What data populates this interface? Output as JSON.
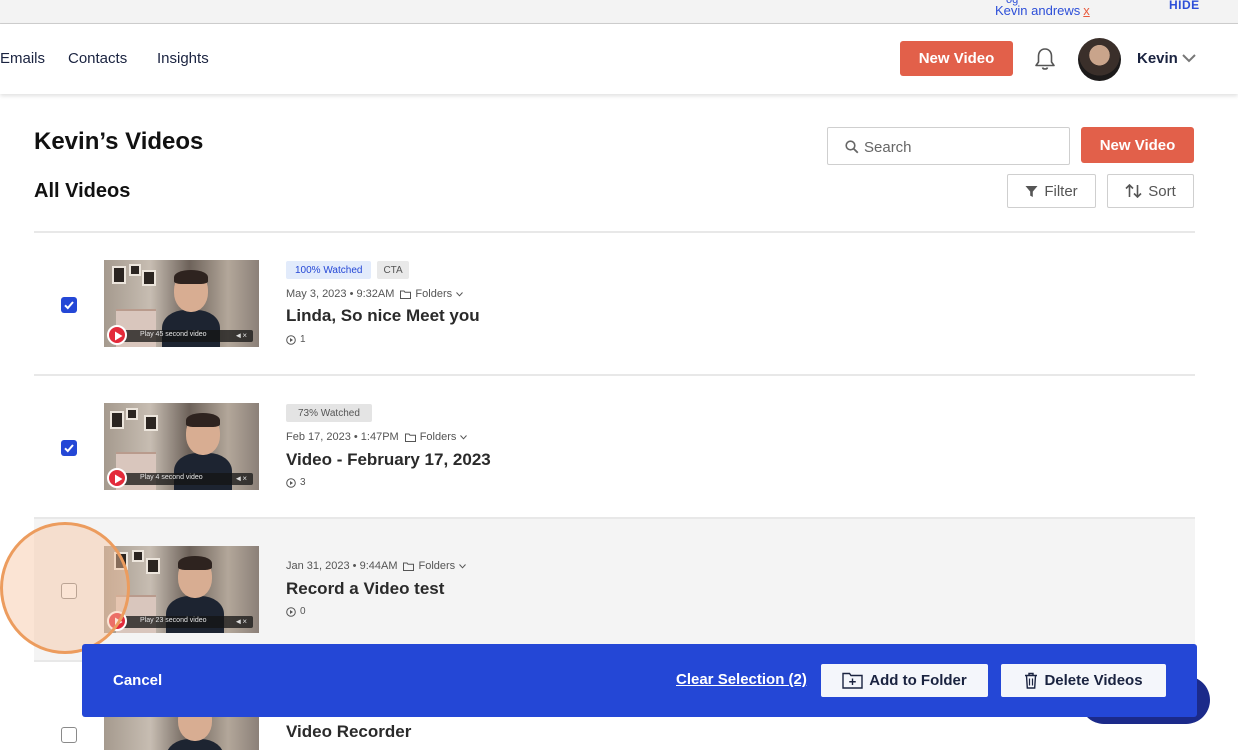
{
  "topbar": {
    "user": "Kevin andrews",
    "close": "x",
    "hide": "HIDE",
    "partial": "og"
  },
  "nav": {
    "links": [
      "Emails",
      "Contacts",
      "Insights"
    ],
    "new_video": "New Video",
    "user_name": "Kevin"
  },
  "header": {
    "title": "Kevin’s Videos",
    "section": "All Videos",
    "search_placeholder": "Search",
    "new_video": "New Video",
    "filter": "Filter",
    "sort": "Sort"
  },
  "videos": [
    {
      "badges": [
        "100% Watched",
        "CTA"
      ],
      "date": "May 3, 2023 • 9:32AM",
      "folders": "Folders",
      "title": "Linda, So nice Meet you",
      "views": "1",
      "thumb_caption": "Play 45 second video",
      "selected": true
    },
    {
      "badges": [
        "73% Watched"
      ],
      "date": "Feb 17, 2023 • 1:47PM",
      "folders": "Folders",
      "title": "Video - February 17, 2023",
      "views": "3",
      "thumb_caption": "Play 4 second video",
      "selected": true
    },
    {
      "badges": [],
      "date": "Jan 31, 2023 • 9:44AM",
      "folders": "Folders",
      "title": "Record a Video test",
      "views": "0",
      "thumb_caption": "Play 23 second video",
      "selected": false
    },
    {
      "badges": [],
      "title": "Video Recorder",
      "selected": false
    }
  ],
  "action_bar": {
    "cancel": "Cancel",
    "clear_selection": "Clear Selection (2)",
    "add_to_folder": "Add to Folder",
    "delete_videos": "Delete Videos"
  },
  "colors": {
    "accent_red": "#e2604a",
    "primary_blue": "#2447d6"
  },
  "icons": [
    "bell-icon",
    "chevron-down-icon",
    "search-icon",
    "filter-icon",
    "sort-icon",
    "folder-icon",
    "play-icon",
    "checkmark-icon",
    "folder-plus-icon",
    "trash-icon"
  ]
}
